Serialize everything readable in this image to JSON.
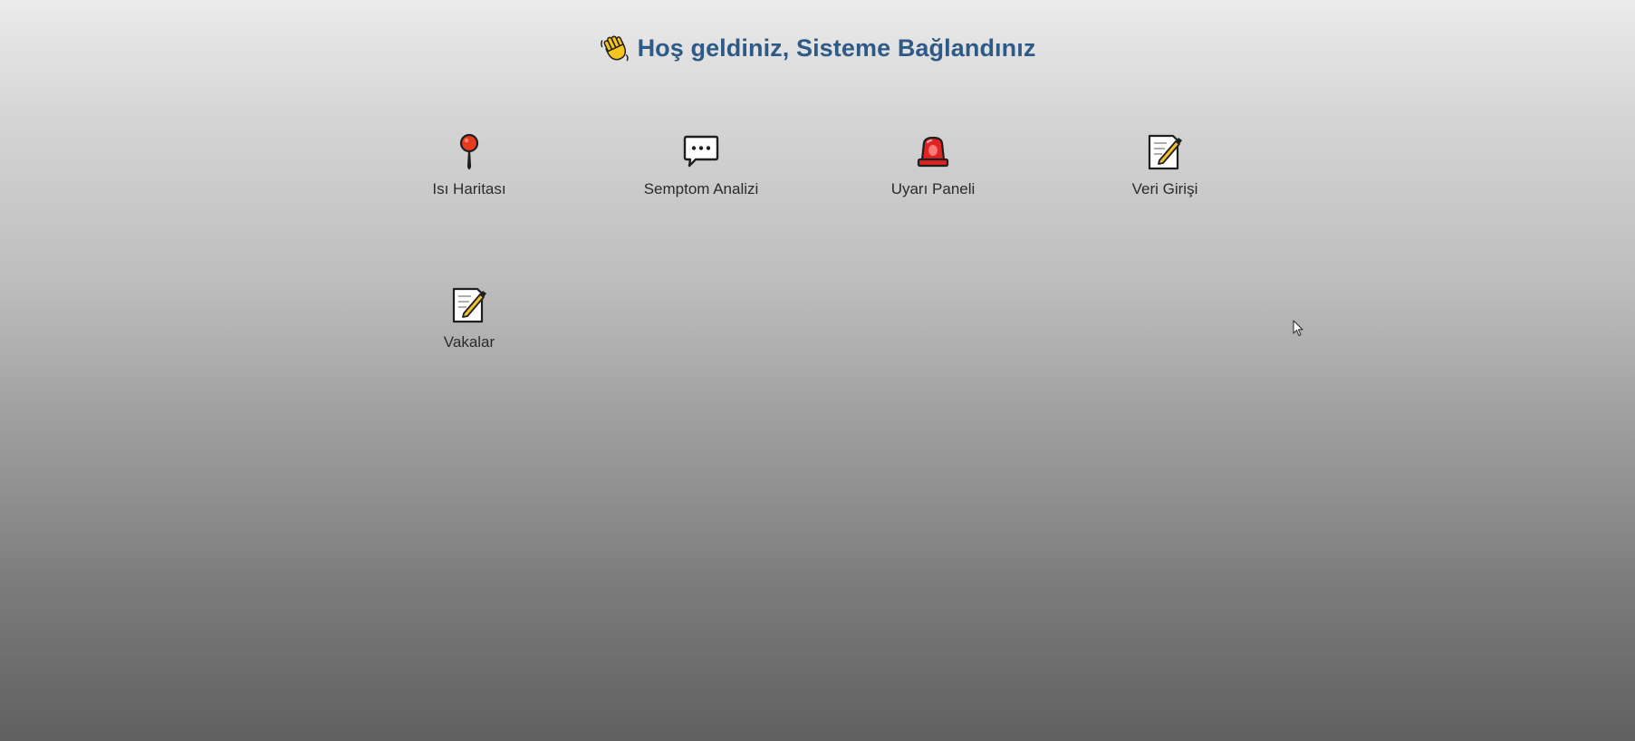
{
  "header": {
    "icon": "waving-hand-icon",
    "title": "Hoş geldiniz, Sisteme Bağlandınız",
    "title_color": "#2e5a87"
  },
  "tiles": [
    {
      "label": "Isı Haritası",
      "icon": "pushpin-icon"
    },
    {
      "label": "Semptom Analizi",
      "icon": "speech-bubble-icon"
    },
    {
      "label": "Uyarı Paneli",
      "icon": "siren-icon"
    },
    {
      "label": "Veri Girişi",
      "icon": "memo-icon"
    },
    {
      "label": "Vakalar",
      "icon": "memo-icon"
    }
  ]
}
